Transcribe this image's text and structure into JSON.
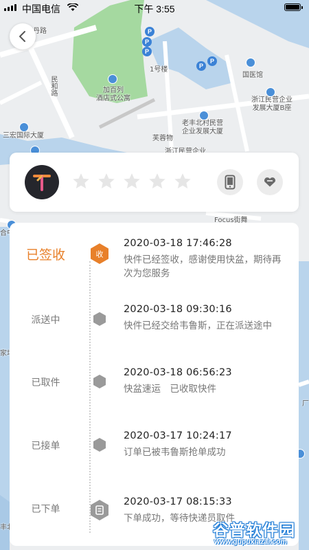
{
  "status_bar": {
    "carrier": "中国电信",
    "time": "下午 3:55"
  },
  "map": {
    "labels": {
      "road_1": "丹路",
      "road_2": "民和路",
      "hotel": "加百列\n酒店式公寓",
      "building_1": "1号楼",
      "museum": "国医馆",
      "ent_dev": "浙江民营企业\n发展大厦B座",
      "laofeng": "老丰北村民营\n企业发展大厦",
      "furong": "芙蓉物",
      "sanhong": "三宏国际大厦",
      "zhejiang_ent": "浙江民营企业",
      "focus": "Focus街舞",
      "edge_1": "合中",
      "edge_2": "厂",
      "edge_3": "家场",
      "edge_4": "丰北"
    },
    "colors": {
      "water": "#b9d4ec",
      "green": "#a5d9a0",
      "land": "#eceef0",
      "road": "#ffffff"
    }
  },
  "back_button": {
    "icon": "chevron-left-icon"
  },
  "courier": {
    "avatar_icon": "courier-logo-icon",
    "rating": 0,
    "star_count": 5,
    "phone_icon": "phone-icon",
    "favorite_icon": "heart-icon"
  },
  "timeline": [
    {
      "status": "已签收",
      "badge": "收",
      "time": "2020-03-18 17:46:28",
      "desc": "快件已经签收，感谢使用快盆，期待再次为您服务",
      "active": true
    },
    {
      "status": "派送中",
      "time": "2020-03-18 09:30:16",
      "desc": "快件已经交给韦鲁斯，正在派送途中",
      "active": false
    },
    {
      "status": "已取件",
      "time": "2020-03-18 06:56:23",
      "desc": "快盆速运　已收取快件",
      "active": false
    },
    {
      "status": "已接单",
      "time": "2020-03-17 10:24:17",
      "desc": "订单已被韦鲁斯抢单成功",
      "active": false
    },
    {
      "status": "已下单",
      "time": "2020-03-17 08:15:33",
      "desc": "下单成功，等待快递员取件",
      "active": false
    }
  ],
  "colors": {
    "accent": "#e8802a",
    "node_grey": "#9a9a9a"
  },
  "watermark": {
    "title": "谷普软件园",
    "url": "www.gupuxiazai.com"
  }
}
